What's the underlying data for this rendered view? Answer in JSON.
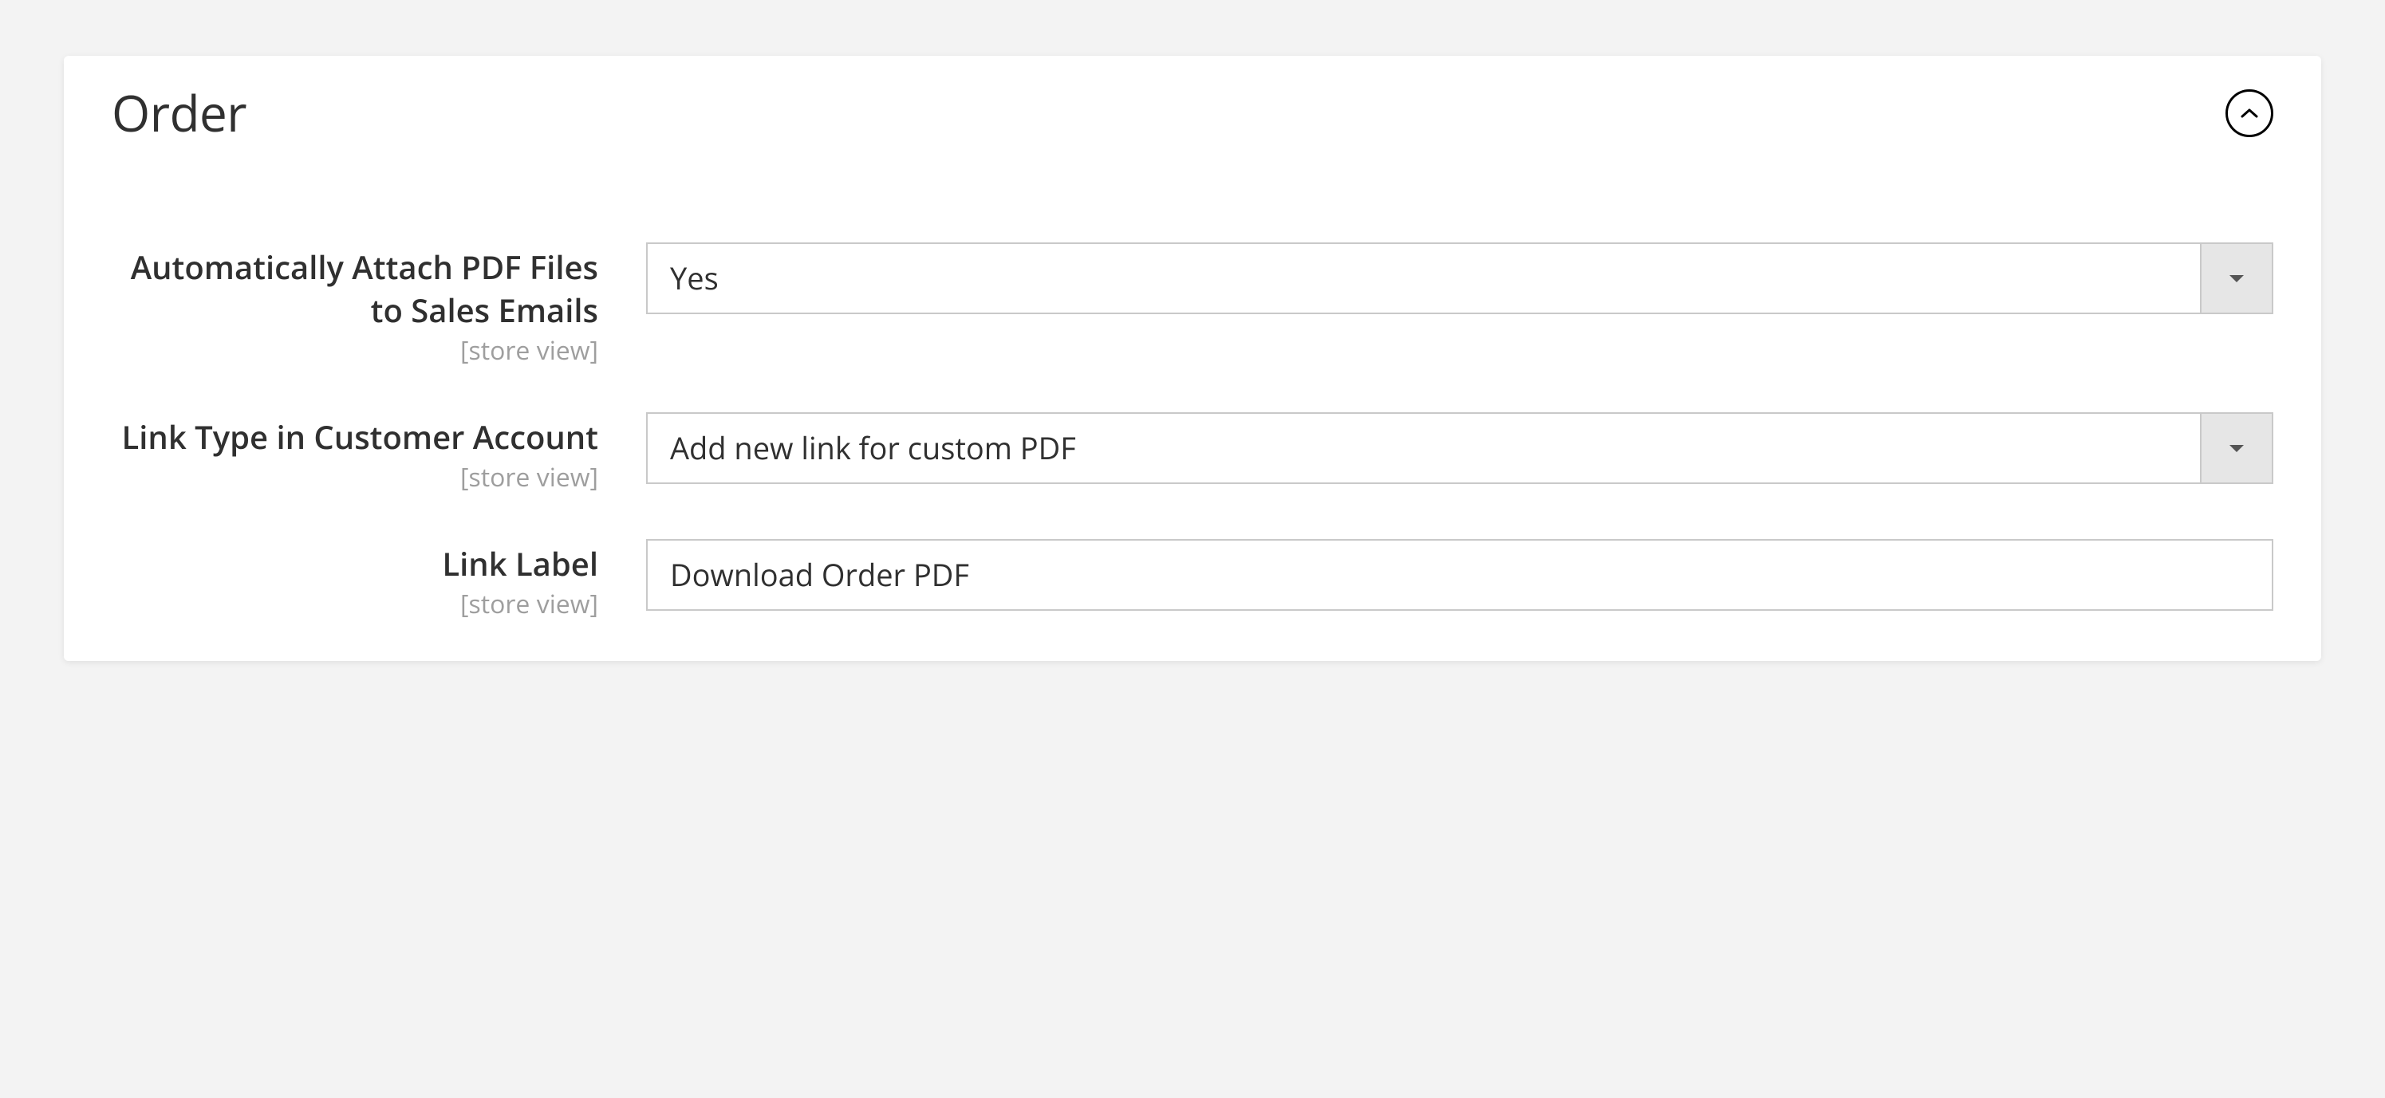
{
  "section": {
    "title": "Order",
    "scope_label": "[store view]",
    "fields": {
      "attach_pdf": {
        "label": "Automatically Attach PDF Files to Sales Emails",
        "value": "Yes"
      },
      "link_type": {
        "label": "Link Type in Customer Account",
        "value": "Add new link for custom PDF"
      },
      "link_label": {
        "label": "Link Label",
        "value": "Download Order PDF"
      }
    }
  }
}
